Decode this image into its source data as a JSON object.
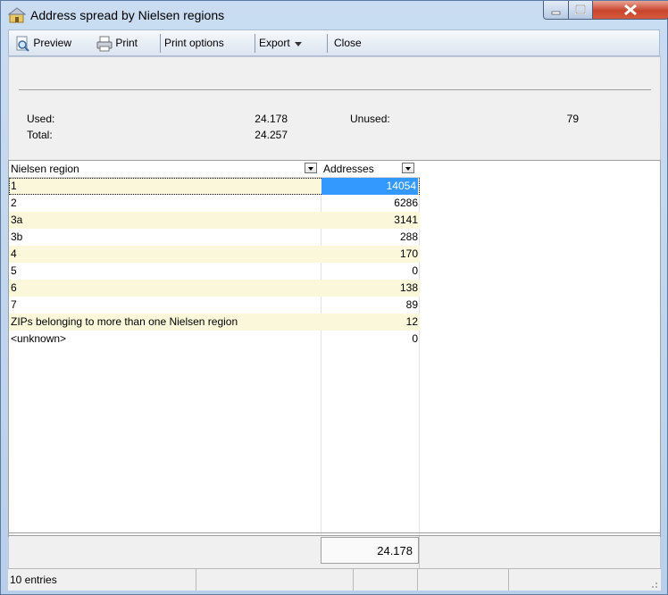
{
  "window": {
    "title": "Address spread by Nielsen regions"
  },
  "toolbar": {
    "preview_label": "Preview",
    "print_label": "Print",
    "print_options_label": "Print options",
    "export_label": "Export",
    "close_label": "Close"
  },
  "summary": {
    "used_label": "Used:",
    "used_value": "24.178",
    "unused_label": "Unused:",
    "unused_value": "79",
    "total_label": "Total:",
    "total_value": "24.257"
  },
  "table": {
    "columns": [
      "Nielsen region",
      "Addresses"
    ],
    "rows": [
      {
        "region": "1",
        "addresses": "14054"
      },
      {
        "region": "2",
        "addresses": "6286"
      },
      {
        "region": "3a",
        "addresses": "3141"
      },
      {
        "region": "3b",
        "addresses": "288"
      },
      {
        "region": "4",
        "addresses": "170"
      },
      {
        "region": "5",
        "addresses": "0"
      },
      {
        "region": "6",
        "addresses": "138"
      },
      {
        "region": "7",
        "addresses": "89"
      },
      {
        "region": "ZIPs belonging to more than one Nielsen region",
        "addresses": "12"
      },
      {
        "region": "<unknown>",
        "addresses": "0"
      }
    ],
    "total": "24.178"
  },
  "statusbar": {
    "entries_text": "10 entries"
  },
  "colors": {
    "selection": "#3399ff",
    "alt_row": "#fbf7da",
    "close_button": "#c8452c"
  }
}
